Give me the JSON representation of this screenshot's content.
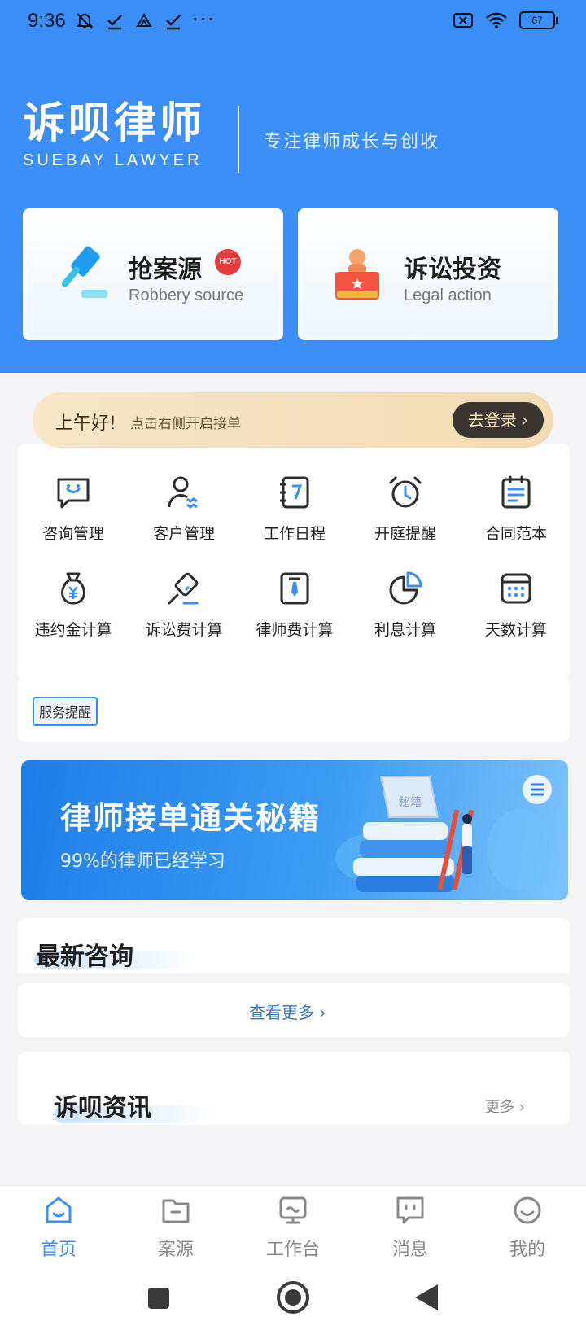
{
  "status_bar": {
    "time": "9:36",
    "more": "···",
    "battery": "67"
  },
  "brand": {
    "name_cn": "诉呗律师",
    "name_en": "SUEBAY LAWYER",
    "slogan": "专注律师成长与创收"
  },
  "features": [
    {
      "title": "抢案源",
      "subtitle": "Robbery source",
      "badge": "HOT"
    },
    {
      "title": "诉讼投资",
      "subtitle": "Legal action"
    }
  ],
  "greeting": {
    "hello": "上午好!",
    "hint": "点击右侧开启接单",
    "login": "去登录 ›"
  },
  "tools": [
    {
      "label": "咨询管理",
      "icon": "chat-smile-icon"
    },
    {
      "label": "客户管理",
      "icon": "customer-icon"
    },
    {
      "label": "工作日程",
      "icon": "calendar-7-icon"
    },
    {
      "label": "开庭提醒",
      "icon": "alarm-clock-icon"
    },
    {
      "label": "合同范本",
      "icon": "clipboard-icon"
    },
    {
      "label": "违约金计算",
      "icon": "money-bag-icon"
    },
    {
      "label": "诉讼费计算",
      "icon": "gavel-pen-icon"
    },
    {
      "label": "律师费计算",
      "icon": "lawyer-tie-icon"
    },
    {
      "label": "利息计算",
      "icon": "pie-chart-icon"
    },
    {
      "label": "天数计算",
      "icon": "calendar-grid-icon"
    }
  ],
  "service_tag": "服务提醒",
  "banner": {
    "title": "律师接单通关秘籍",
    "subtitle": "99%的律师已经学习",
    "book_text": "秘籍"
  },
  "latest": {
    "title": "最新咨询",
    "more": "查看更多 ›"
  },
  "news": {
    "title": "诉呗资讯",
    "more": "更多 ›"
  },
  "tabs": [
    {
      "label": "首页",
      "active": true
    },
    {
      "label": "案源"
    },
    {
      "label": "工作台"
    },
    {
      "label": "消息"
    },
    {
      "label": "我的"
    }
  ],
  "colors": {
    "primary": "#3a8ef5",
    "hot": "#e8393b",
    "gold": "#f2dbb2"
  }
}
